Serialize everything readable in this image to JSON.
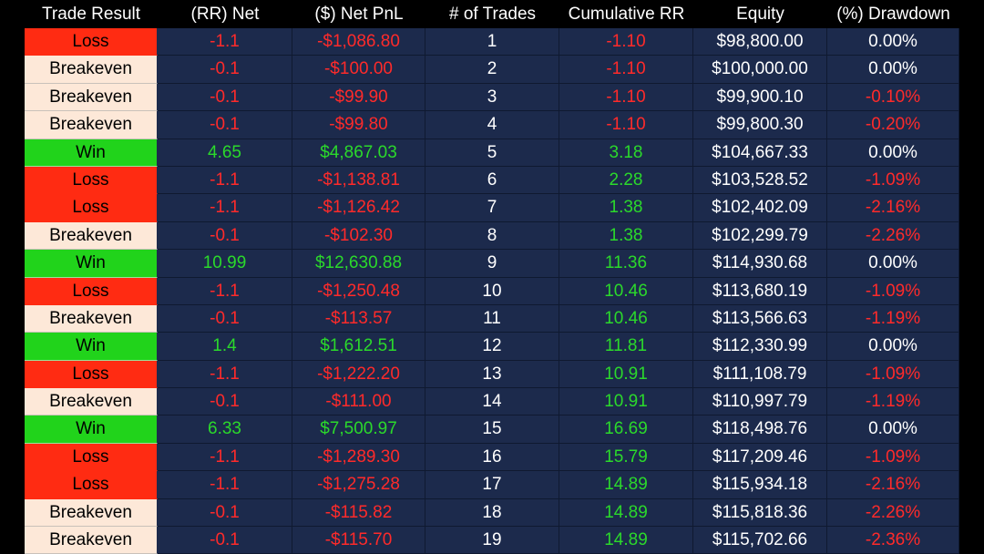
{
  "table": {
    "columns": [
      "Trade Result",
      "(RR) Net",
      "($) Net PnL",
      "# of Trades",
      "Cumulative RR",
      "Equity",
      "(%) Drawdown"
    ],
    "rows": [
      {
        "result": "Loss",
        "kind": "loss",
        "rr": "-1.1",
        "pnl": "-$1,086.80",
        "trades": "1",
        "cum": "-1.10",
        "equity": "$98,800.00",
        "dd": "0.00%"
      },
      {
        "result": "Breakeven",
        "kind": "breakeven",
        "rr": "-0.1",
        "pnl": "-$100.00",
        "trades": "2",
        "cum": "-1.10",
        "equity": "$100,000.00",
        "dd": "0.00%"
      },
      {
        "result": "Breakeven",
        "kind": "breakeven",
        "rr": "-0.1",
        "pnl": "-$99.90",
        "trades": "3",
        "cum": "-1.10",
        "equity": "$99,900.10",
        "dd": "-0.10%"
      },
      {
        "result": "Breakeven",
        "kind": "breakeven",
        "rr": "-0.1",
        "pnl": "-$99.80",
        "trades": "4",
        "cum": "-1.10",
        "equity": "$99,800.30",
        "dd": "-0.20%"
      },
      {
        "result": "Win",
        "kind": "win",
        "rr": "4.65",
        "pnl": "$4,867.03",
        "trades": "5",
        "cum": "3.18",
        "equity": "$104,667.33",
        "dd": "0.00%"
      },
      {
        "result": "Loss",
        "kind": "loss",
        "rr": "-1.1",
        "pnl": "-$1,138.81",
        "trades": "6",
        "cum": "2.28",
        "equity": "$103,528.52",
        "dd": "-1.09%"
      },
      {
        "result": "Loss",
        "kind": "loss",
        "rr": "-1.1",
        "pnl": "-$1,126.42",
        "trades": "7",
        "cum": "1.38",
        "equity": "$102,402.09",
        "dd": "-2.16%"
      },
      {
        "result": "Breakeven",
        "kind": "breakeven",
        "rr": "-0.1",
        "pnl": "-$102.30",
        "trades": "8",
        "cum": "1.38",
        "equity": "$102,299.79",
        "dd": "-2.26%"
      },
      {
        "result": "Win",
        "kind": "win",
        "rr": "10.99",
        "pnl": "$12,630.88",
        "trades": "9",
        "cum": "11.36",
        "equity": "$114,930.68",
        "dd": "0.00%"
      },
      {
        "result": "Loss",
        "kind": "loss",
        "rr": "-1.1",
        "pnl": "-$1,250.48",
        "trades": "10",
        "cum": "10.46",
        "equity": "$113,680.19",
        "dd": "-1.09%"
      },
      {
        "result": "Breakeven",
        "kind": "breakeven",
        "rr": "-0.1",
        "pnl": "-$113.57",
        "trades": "11",
        "cum": "10.46",
        "equity": "$113,566.63",
        "dd": "-1.19%"
      },
      {
        "result": "Win",
        "kind": "win",
        "rr": "1.4",
        "pnl": "$1,612.51",
        "trades": "12",
        "cum": "11.81",
        "equity": "$112,330.99",
        "dd": "0.00%"
      },
      {
        "result": "Loss",
        "kind": "loss",
        "rr": "-1.1",
        "pnl": "-$1,222.20",
        "trades": "13",
        "cum": "10.91",
        "equity": "$111,108.79",
        "dd": "-1.09%"
      },
      {
        "result": "Breakeven",
        "kind": "breakeven",
        "rr": "-0.1",
        "pnl": "-$111.00",
        "trades": "14",
        "cum": "10.91",
        "equity": "$110,997.79",
        "dd": "-1.19%"
      },
      {
        "result": "Win",
        "kind": "win",
        "rr": "6.33",
        "pnl": "$7,500.97",
        "trades": "15",
        "cum": "16.69",
        "equity": "$118,498.76",
        "dd": "0.00%"
      },
      {
        "result": "Loss",
        "kind": "loss",
        "rr": "-1.1",
        "pnl": "-$1,289.30",
        "trades": "16",
        "cum": "15.79",
        "equity": "$117,209.46",
        "dd": "-1.09%"
      },
      {
        "result": "Loss",
        "kind": "loss",
        "rr": "-1.1",
        "pnl": "-$1,275.28",
        "trades": "17",
        "cum": "14.89",
        "equity": "$115,934.18",
        "dd": "-2.16%"
      },
      {
        "result": "Breakeven",
        "kind": "breakeven",
        "rr": "-0.1",
        "pnl": "-$115.82",
        "trades": "18",
        "cum": "14.89",
        "equity": "$115,818.36",
        "dd": "-2.26%"
      },
      {
        "result": "Breakeven",
        "kind": "breakeven",
        "rr": "-0.1",
        "pnl": "-$115.70",
        "trades": "19",
        "cum": "14.89",
        "equity": "$115,702.66",
        "dd": "-2.36%"
      }
    ]
  },
  "colors": {
    "positive": "#2bd92b",
    "negative": "#ff2a2a",
    "neutral": "#ffffff",
    "loss_fill": "#ff2b12",
    "win_fill": "#21d31b",
    "breakeven_fill": "#fde8d8",
    "cell_fill": "#1c2a4c"
  }
}
